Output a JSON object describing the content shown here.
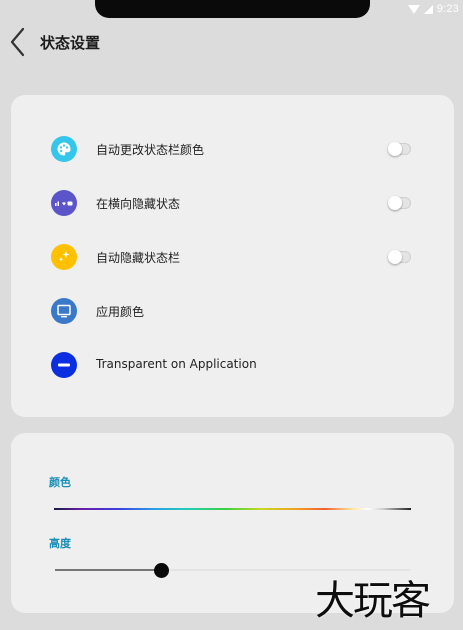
{
  "status_bar": {
    "time": "9:23"
  },
  "header": {
    "title": "状态设置"
  },
  "settings": [
    {
      "label": "自动更改状态栏颜色",
      "icon": "palette-icon",
      "icon_color": "#35c6ec",
      "has_toggle": true,
      "toggle_on": false
    },
    {
      "label": "在横向隐藏状态",
      "icon": "statusbar-landscape-icon",
      "icon_color": "#5b55c9",
      "has_toggle": true,
      "toggle_on": false
    },
    {
      "label": "自动隐藏状态栏",
      "icon": "sparkle-icon",
      "icon_color": "#ffc000",
      "has_toggle": true,
      "toggle_on": false
    },
    {
      "label": "应用颜色",
      "icon": "monitor-icon",
      "icon_color": "#3a78c8",
      "has_toggle": false
    },
    {
      "label": "Transparent on Application",
      "icon": "minus-circle-icon",
      "icon_color": "#0b2fe0",
      "has_toggle": false
    }
  ],
  "color_section": {
    "label": "颜色"
  },
  "height_section": {
    "label": "高度",
    "value_fraction": 0.3
  },
  "watermark": {
    "text": "大玩客"
  }
}
